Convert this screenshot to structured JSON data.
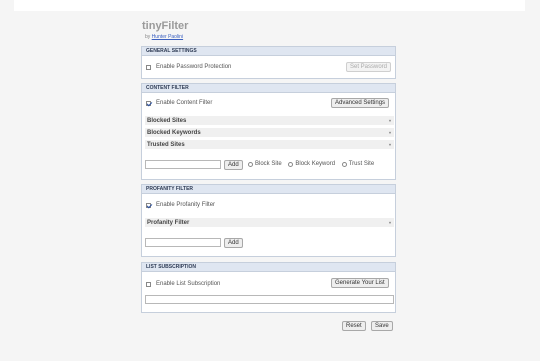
{
  "app": {
    "title": "tinyFilter",
    "byline_prefix": "by",
    "author": "Hunter Paolini"
  },
  "general": {
    "header": "GENERAL SETTINGS",
    "password_label": "Enable Password Protection",
    "password_checked": false,
    "set_password_button": "Set Password"
  },
  "content": {
    "header": "CONTENT FILTER",
    "enable_label": "Enable Content Filter",
    "enable_checked": true,
    "advanced_button": "Advanced Settings",
    "lists": [
      "Blocked Sites",
      "Blocked Keywords",
      "Trusted Sites"
    ],
    "add_button": "Add",
    "input_value": "",
    "radio_options": [
      "Block Site",
      "Block Keyword",
      "Trust Site"
    ]
  },
  "profanity": {
    "header": "PROFANITY FILTER",
    "enable_label": "Enable Profanity Filter",
    "enable_checked": true,
    "list": "Profanity Filter",
    "add_button": "Add",
    "input_value": ""
  },
  "subscription": {
    "header": "LIST SUBSCRIPTION",
    "enable_label": "Enable List Subscription",
    "enable_checked": false,
    "generate_button": "Generate Your List",
    "url_value": ""
  },
  "footer": {
    "reset_button": "Reset",
    "save_button": "Save"
  },
  "colors": {
    "section_header_bg": "#dfe6f1",
    "section_border": "#c6cfdc",
    "link": "#3a5fc0"
  }
}
